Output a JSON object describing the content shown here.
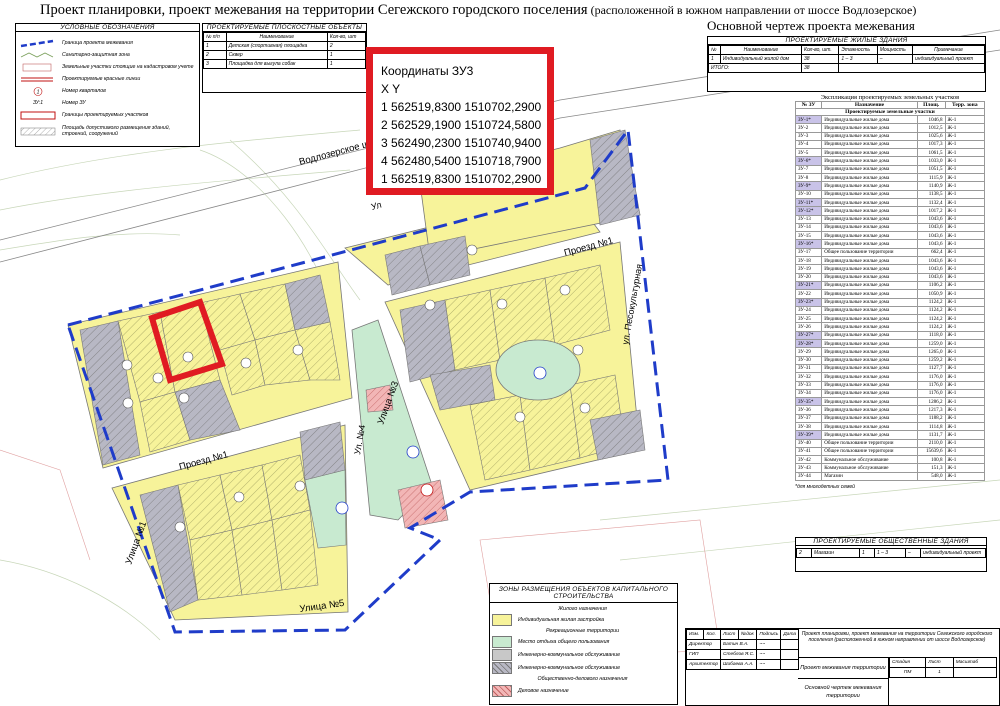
{
  "title": {
    "main": "Проект планировки, проект межевания на территории Сегежского городского поселения",
    "sub": " (расположенной в южном направлении от шоссе Водлозерское)"
  },
  "subtitle": "Основной чертеж проекта межевания",
  "legend": {
    "title": "УСЛОВНЫЕ ОБОЗНАЧЕНИЯ",
    "items": [
      "Граница проекта межевания",
      "Санитарно-защитная зона",
      "Земельные участки стоящие на кадастровом учете",
      "Проектируемые красные линии",
      "Номер кварталов",
      "Номер ЗУ",
      "Границы проектируемых участков",
      "Площадь допустимого размещения зданий, строений, сооружений"
    ],
    "sample_parcel": "ЗУ:1",
    "sample_quarter": "1"
  },
  "planar_objects": {
    "title": "ПРОЕКТИРУЕМЫЕ ПЛОСКОСТНЫЕ ОБЪЕКТЫ",
    "headers": [
      "№ п/п",
      "Наименование",
      "Кол-во, шт"
    ],
    "rows": [
      [
        "1",
        "Детская (спортивная) площадка",
        "2"
      ],
      [
        "2",
        "Сквер",
        "1"
      ],
      [
        "3",
        "Площадка для выгула собак",
        "1"
      ]
    ]
  },
  "coords": {
    "title": "Координаты ЗУ3",
    "axes": "X Y",
    "rows": [
      "1 562519,8300  1510702,2900",
      "2 562529,1900  1510724,5800",
      "3 562490,2300  1510740,9400",
      "4 562480,5400  1510718,7900",
      "1 562519,8300  1510702,2900"
    ]
  },
  "residential": {
    "title": "ПРОЕКТИРУЕМЫЕ ЖИЛЫЕ ЗДАНИЯ",
    "headers": [
      "№",
      "Наименование",
      "Кол-во, шт.",
      "Этажность",
      "Мощность",
      "Примечание"
    ],
    "row": [
      "1",
      "Индивидуальный жилой дом",
      "38",
      "1 – 3",
      "–",
      "индивидуальный проект"
    ],
    "total_label": "ИТОГО:",
    "total_value": "38"
  },
  "explication": {
    "title": "Экспликация проектируемых земельных участков",
    "headers": [
      "№ ЗУ",
      "Назначение",
      "Площ.",
      "Терр. зона"
    ],
    "section": "Проектируемые земельные участки",
    "rows": [
      [
        "ЗУ-1*",
        "Индивидуальные жилые дома",
        "1046,8",
        "Ж-1",
        true
      ],
      [
        "ЗУ-2",
        "Индивидуальные жилые дома",
        "1012,5",
        "Ж-1",
        false
      ],
      [
        "ЗУ-3",
        "Индивидуальные жилые дома",
        "1025,6",
        "Ж-1",
        false
      ],
      [
        "ЗУ-4",
        "Индивидуальные жилые дома",
        "1017,3",
        "Ж-1",
        false
      ],
      [
        "ЗУ-5",
        "Индивидуальные жилые дома",
        "1061,5",
        "Ж-1",
        false
      ],
      [
        "ЗУ-6*",
        "Индивидуальные жилые дома",
        "1033,0",
        "Ж-1",
        true
      ],
      [
        "ЗУ-7",
        "Индивидуальные жилые дома",
        "1051,5",
        "Ж-1",
        false
      ],
      [
        "ЗУ-8",
        "Индивидуальные жилые дома",
        "1115,9",
        "Ж-1",
        false
      ],
      [
        "ЗУ-9*",
        "Индивидуальные жилые дома",
        "1140,9",
        "Ж-1",
        true
      ],
      [
        "ЗУ-10",
        "Индивидуальные жилые дома",
        "1138,5",
        "Ж-1",
        false
      ],
      [
        "ЗУ-11*",
        "Индивидуальные жилые дома",
        "1132,4",
        "Ж-1",
        true
      ],
      [
        "ЗУ-12*",
        "Индивидуальные жилые дома",
        "1017,2",
        "Ж-1",
        true
      ],
      [
        "ЗУ-13",
        "Индивидуальные жилые дома",
        "1043,6",
        "Ж-1",
        false
      ],
      [
        "ЗУ-14",
        "Индивидуальные жилые дома",
        "1043,6",
        "Ж-1",
        false
      ],
      [
        "ЗУ-15",
        "Индивидуальные жилые дома",
        "1043,6",
        "Ж-1",
        false
      ],
      [
        "ЗУ-16*",
        "Индивидуальные жилые дома",
        "1043,6",
        "Ж-1",
        true
      ],
      [
        "ЗУ-17",
        "Общее пользование территории",
        "662,4",
        "Ж-1",
        false
      ],
      [
        "ЗУ-18",
        "Индивидуальные жилые дома",
        "1043,6",
        "Ж-1",
        false
      ],
      [
        "ЗУ-19",
        "Индивидуальные жилые дома",
        "1043,6",
        "Ж-1",
        false
      ],
      [
        "ЗУ-20",
        "Индивидуальные жилые дома",
        "1043,6",
        "Ж-1",
        false
      ],
      [
        "ЗУ-21*",
        "Индивидуальные жилые дома",
        "1106,2",
        "Ж-1",
        true
      ],
      [
        "ЗУ-22",
        "Индивидуальные жилые дома",
        "1050,9",
        "Ж-1",
        false
      ],
      [
        "ЗУ-23*",
        "Индивидуальные жилые дома",
        "1124,2",
        "Ж-1",
        true
      ],
      [
        "ЗУ-24",
        "Индивидуальные жилые дома",
        "1124,2",
        "Ж-1",
        false
      ],
      [
        "ЗУ-25",
        "Индивидуальные жилые дома",
        "1124,2",
        "Ж-1",
        false
      ],
      [
        "ЗУ-26",
        "Индивидуальные жилые дома",
        "1124,2",
        "Ж-1",
        false
      ],
      [
        "ЗУ-27*",
        "Индивидуальные жилые дома",
        "1118,0",
        "Ж-1",
        true
      ],
      [
        "ЗУ-28*",
        "Индивидуальные жилые дома",
        "1259,0",
        "Ж-1",
        true
      ],
      [
        "ЗУ-29",
        "Индивидуальные жилые дома",
        "1265,0",
        "Ж-1",
        false
      ],
      [
        "ЗУ-30",
        "Индивидуальные жилые дома",
        "1259,2",
        "Ж-1",
        false
      ],
      [
        "ЗУ-31",
        "Индивидуальные жилые дома",
        "1127,7",
        "Ж-1",
        false
      ],
      [
        "ЗУ-32",
        "Индивидуальные жилые дома",
        "1176,0",
        "Ж-1",
        false
      ],
      [
        "ЗУ-33",
        "Индивидуальные жилые дома",
        "1176,0",
        "Ж-1",
        false
      ],
      [
        "ЗУ-34",
        "Индивидуальные жилые дома",
        "1176,0",
        "Ж-1",
        false
      ],
      [
        "ЗУ-35*",
        "Индивидуальные жилые дома",
        "1286,2",
        "Ж-1",
        true
      ],
      [
        "ЗУ-36",
        "Индивидуальные жилые дома",
        "1217,3",
        "Ж-1",
        false
      ],
      [
        "ЗУ-37",
        "Индивидуальные жилые дома",
        "1188,2",
        "Ж-1",
        false
      ],
      [
        "ЗУ-38",
        "Индивидуальные жилые дома",
        "1114,8",
        "Ж-1",
        false
      ],
      [
        "ЗУ-39*",
        "Индивидуальные жилые дома",
        "1131,7",
        "Ж-1",
        true
      ],
      [
        "ЗУ-40",
        "Общее пользование территории",
        "2110,0",
        "Ж-1",
        false
      ],
      [
        "ЗУ-41",
        "Общее пользование территории",
        "15639,6",
        "Ж-1",
        false
      ],
      [
        "ЗУ-42",
        "Коммунальное обслуживание",
        "100,8",
        "Ж-1",
        false
      ],
      [
        "ЗУ-43",
        "Коммунальное обслуживание",
        "151,3",
        "Ж-1",
        false
      ],
      [
        "ЗУ-44",
        "Магазин",
        "548,0",
        "Ж-1",
        false
      ]
    ],
    "footnote": "*для многодетных семей"
  },
  "public_buildings": {
    "title": "ПРОЕКТИРУЕМЫЕ ОБЩЕСТВЕННЫЕ ЗДАНИЯ",
    "row": [
      "2",
      "Магазин",
      "1",
      "1 – 3",
      "–",
      "индивидуальный проект"
    ]
  },
  "zones": {
    "title": "ЗОНЫ РАЗМЕЩЕНИЯ ОБЪЕКТОВ КАПИТАЛЬНОГО СТРОИТЕЛЬСТВА",
    "cat_residential": "Жилого назначения",
    "cat_recreation": "Рекреационные территории",
    "cat_public": "Общественно-делового назначения",
    "items": {
      "indiv": "Индивидуальная жилая застройка",
      "rest": "Место отдыха общего пользования",
      "eng1": "Инженерно-коммунальное обслуживание",
      "eng2": "Инженерно-коммунальное обслуживание",
      "business": "Деловое назначение"
    },
    "colors": {
      "indiv": "#f7f39a",
      "rest": "#c8ead0",
      "eng": "#c8c8c8",
      "business": "#f2b6b6"
    }
  },
  "stamp": {
    "headers": [
      "Изм.",
      "Кол.",
      "Лист",
      "№док",
      "Подпись",
      "Дата"
    ],
    "people": [
      [
        "Директор",
        "Батин В.А."
      ],
      [
        "ГИП",
        "Стеблов Я.С."
      ],
      [
        "Архитектор",
        "Шибаева А.А."
      ]
    ],
    "project": "Проект планировки, проект межевания на территории Сегежского городского поселения (расположенной в южном направлении от шоссе Водлозерское)",
    "doc": "Проект межевания территории",
    "sheet_name": "Основной чертеж межевания территории",
    "stage_label": "Стадия",
    "sheet_label": "Лист",
    "scale_label": "Масштаб",
    "stage": "ПМ",
    "sheet": "1"
  },
  "map": {
    "road_vodlozero": "Водлозерское шоссе",
    "road_proezd1_left": "Проезд №1",
    "road_proezd1_right": "Проезд №1",
    "road_ul3": "Улица №3",
    "road_ul4": "Ул. №4",
    "road_ul5": "Улица №5",
    "road_ul1": "Улица №1",
    "road_pesko": "ул. Песокультурная",
    "road_top": "Ул"
  }
}
